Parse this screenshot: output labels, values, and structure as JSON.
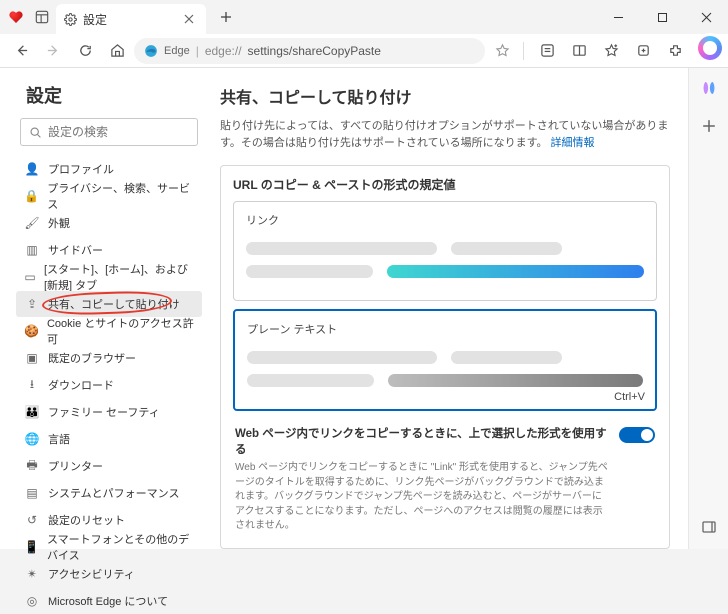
{
  "tab": {
    "title": "設定"
  },
  "address": {
    "label": "Edge",
    "scheme": "edge://",
    "path": "settings/shareCopyPaste"
  },
  "sidebar": {
    "title": "設定",
    "search_placeholder": "設定の検索",
    "items": [
      {
        "label": "プロファイル"
      },
      {
        "label": "プライバシー、検索、サービス"
      },
      {
        "label": "外観"
      },
      {
        "label": "サイドバー"
      },
      {
        "label": "[スタート]、[ホーム]、および [新規] タブ"
      },
      {
        "label": "共有、コピーして貼り付け"
      },
      {
        "label": "Cookie とサイトのアクセス許可"
      },
      {
        "label": "既定のブラウザー"
      },
      {
        "label": "ダウンロード"
      },
      {
        "label": "ファミリー セーフティ"
      },
      {
        "label": "言語"
      },
      {
        "label": "プリンター"
      },
      {
        "label": "システムとパフォーマンス"
      },
      {
        "label": "設定のリセット"
      },
      {
        "label": "スマートフォンとその他のデバイス"
      },
      {
        "label": "アクセシビリティ"
      },
      {
        "label": "Microsoft Edge について"
      }
    ]
  },
  "main": {
    "heading": "共有、コピーして貼り付け",
    "description": "貼り付け先によっては、すべての貼り付けオプションがサポートされていない場合があります。その場合は貼り付け先はサポートされている場所になります。",
    "learn_more": "詳細情報",
    "card_title": "URL のコピー & ペーストの形式の規定値",
    "option_link": "リンク",
    "option_plain": "プレーン テキスト",
    "shortcut": "Ctrl+V",
    "footer_title": "Web ページ内でリンクをコピーするときに、上で選択した形式を使用する",
    "footer_desc": "Web ページ内でリンクをコピーするときに \"Link\" 形式を使用すると、ジャンプ先ページのタイトルを取得するために、リンク先ページがバックグラウンドで読み込まれます。バックグラウンドでジャンプ先ページを読み込むと、ページがサーバーにアクセスすることになります。ただし、ページへのアクセスは閲覧の履歴には表示されません。"
  }
}
